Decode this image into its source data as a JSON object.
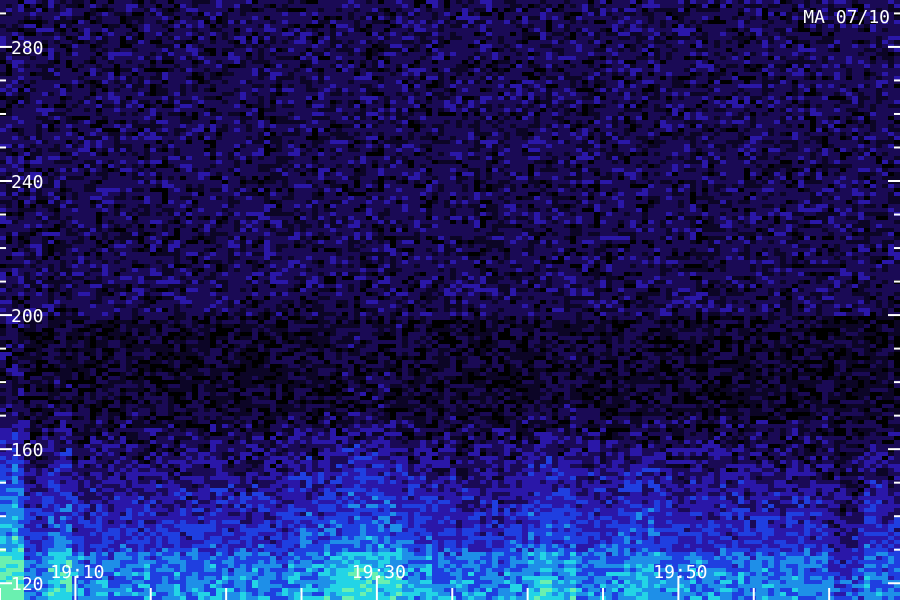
{
  "chart_data": {
    "type": "heatmap",
    "title": "MA 07/10",
    "xlabel": "",
    "ylabel": "",
    "x_major_ticks": [
      {
        "label": "19:10",
        "minutes": 10
      },
      {
        "label": "19:30",
        "minutes": 30
      },
      {
        "label": "19:50",
        "minutes": 50
      }
    ],
    "x_minor_tick_step_minutes": 5,
    "xlim_minutes_after_1900": [
      5,
      64.7
    ],
    "y_ticks": [
      120,
      160,
      200,
      240,
      280
    ],
    "y_minor_tick_step": 10,
    "ylim": [
      115,
      294
    ],
    "colormap": [
      "#000000",
      "#1a0a55",
      "#2a17a8",
      "#1f3fe0",
      "#1e8fe8",
      "#23d4e6",
      "#6af0b0"
    ],
    "intensity_notes": "Strongest emission below ~160 MHz; bright columns near 19:05 and 19:25-19:33"
  }
}
